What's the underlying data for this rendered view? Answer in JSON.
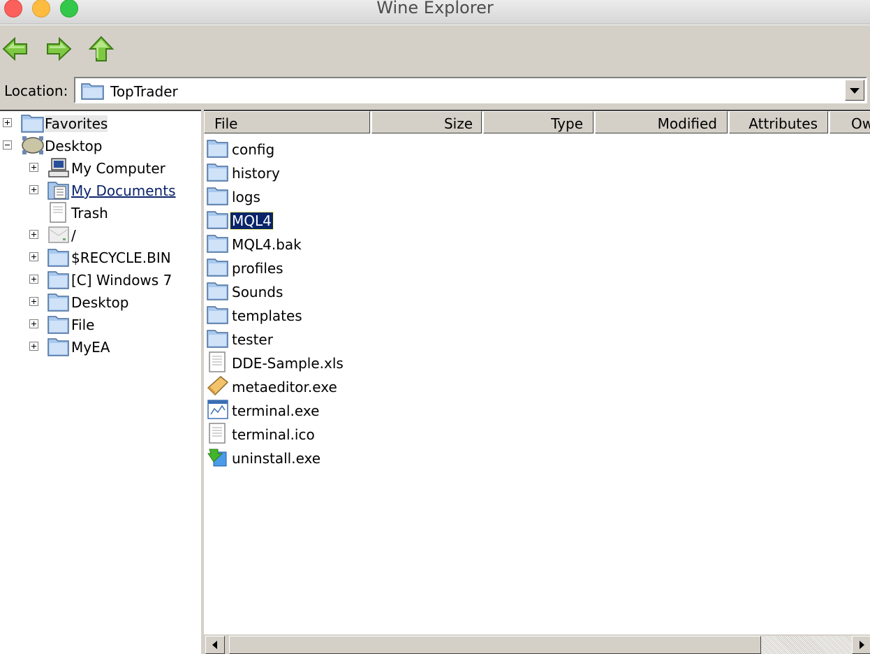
{
  "window": {
    "title": "Wine Explorer"
  },
  "toolbar": {
    "back_icon": "back-arrow-icon",
    "forward_icon": "forward-arrow-icon",
    "up_icon": "up-arrow-icon"
  },
  "location": {
    "label": "Location:",
    "value": "TopTrader"
  },
  "tree": {
    "favorites": "Favorites",
    "desktop": "Desktop",
    "items": [
      {
        "label": "My Computer"
      },
      {
        "label": "My Documents"
      },
      {
        "label": "Trash"
      },
      {
        "label": "/"
      },
      {
        "label": "$RECYCLE.BIN"
      },
      {
        "label": "[C] Windows 7"
      },
      {
        "label": "Desktop"
      },
      {
        "label": "File"
      },
      {
        "label": "MyEA"
      }
    ]
  },
  "list": {
    "columns": [
      "File",
      "Size",
      "Type",
      "Modified",
      "Attributes",
      "Ow"
    ],
    "files": [
      {
        "name": "config",
        "icon": "folder-icon"
      },
      {
        "name": "history",
        "icon": "folder-icon"
      },
      {
        "name": "logs",
        "icon": "folder-icon"
      },
      {
        "name": "MQL4",
        "icon": "folder-icon",
        "selected": true
      },
      {
        "name": "MQL4.bak",
        "icon": "folder-icon"
      },
      {
        "name": "profiles",
        "icon": "folder-icon"
      },
      {
        "name": "Sounds",
        "icon": "folder-icon"
      },
      {
        "name": "templates",
        "icon": "folder-icon"
      },
      {
        "name": "tester",
        "icon": "folder-icon"
      },
      {
        "name": "DDE-Sample.xls",
        "icon": "document-icon"
      },
      {
        "name": "metaeditor.exe",
        "icon": "editor-app-icon"
      },
      {
        "name": "terminal.exe",
        "icon": "terminal-app-icon"
      },
      {
        "name": "terminal.ico",
        "icon": "document-icon"
      },
      {
        "name": "uninstall.exe",
        "icon": "uninstall-app-icon"
      }
    ]
  }
}
